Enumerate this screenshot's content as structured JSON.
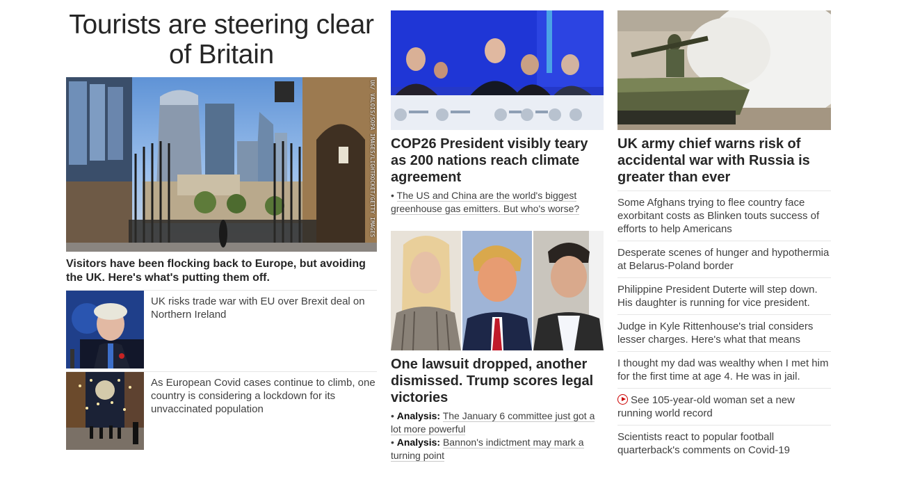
{
  "lead": {
    "headline": "Tourists are steering clear of Britain",
    "image_credit": "UK/ VALOIS/SOPA IMAGES/LIGHTROCKET/GETTY IMAGES",
    "caption": "Visitors have been flocking back to Europe, but avoiding the UK. Here's what's putting them off."
  },
  "side_stories": [
    {
      "headline": "UK risks trade war with EU over Brexit deal on Northern Ireland"
    },
    {
      "headline": "As European Covid cases continue to climb, one country is considering a lockdown for its unvaccinated population"
    }
  ],
  "middle": {
    "story1": {
      "headline": "COP26 President visibly teary as 200 nations reach climate agreement",
      "bullet": "The US and China are the world's biggest greenhouse gas emitters. But who's worse?"
    },
    "story2": {
      "headline": "One lawsuit dropped, another dismissed. Trump scores legal victories",
      "bullets": [
        {
          "label": "Analysis:",
          "text": "The January 6 committee just got a lot more powerful"
        },
        {
          "label": "Analysis:",
          "text": "Bannon's indictment may mark a turning point"
        }
      ]
    }
  },
  "right": {
    "headline": "UK army chief warns risk of accidental war with Russia is greater than ever",
    "list": [
      "Some Afghans trying to flee country face exorbitant costs as Blinken touts success of efforts to help Americans",
      "Desperate scenes of hunger and hypothermia at Belarus-Poland border",
      "Philippine President Duterte will step down. His daughter is running for vice president.",
      "Judge in Kyle Rittenhouse's trial considers lesser charges. Here's what that means",
      "I thought my dad was wealthy when I met him for the first time at age 4. He was in jail.",
      "See 105-year-old woman set a new running world record",
      "Scientists react to popular football quarterback's comments on Covid-19"
    ]
  },
  "bullet_marker": "•",
  "colors": {
    "text": "#262626",
    "muted": "#404040",
    "video_red": "#cc0000",
    "rule": "#e6e6e6"
  },
  "icons": {
    "video": "play-circle-icon"
  }
}
